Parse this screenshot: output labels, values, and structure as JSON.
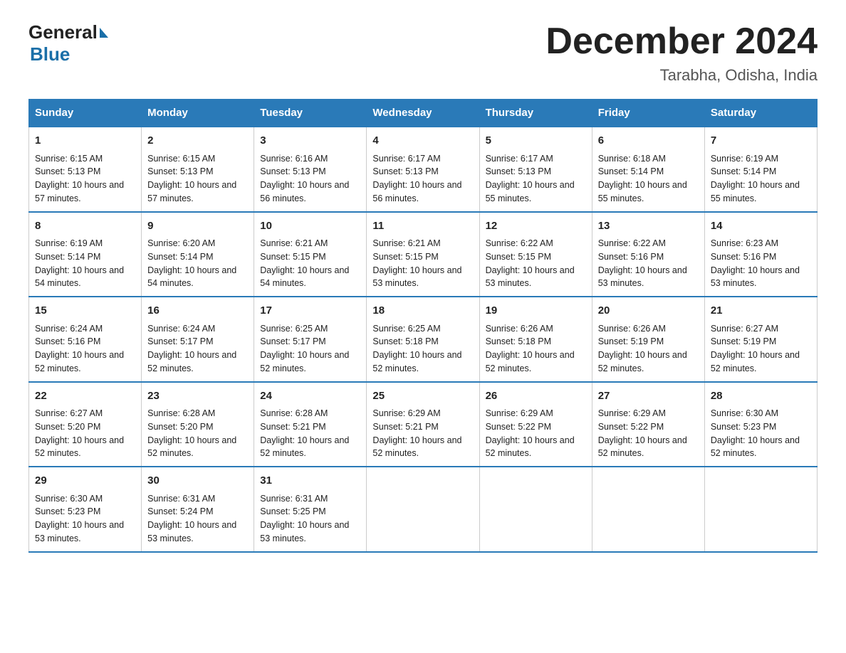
{
  "logo": {
    "general": "General",
    "blue": "Blue",
    "arrow_alt": "logo arrow"
  },
  "title": "December 2024",
  "subtitle": "Tarabha, Odisha, India",
  "days_of_week": [
    "Sunday",
    "Monday",
    "Tuesday",
    "Wednesday",
    "Thursday",
    "Friday",
    "Saturday"
  ],
  "weeks": [
    [
      {
        "day": "1",
        "sunrise": "6:15 AM",
        "sunset": "5:13 PM",
        "daylight": "10 hours and 57 minutes."
      },
      {
        "day": "2",
        "sunrise": "6:15 AM",
        "sunset": "5:13 PM",
        "daylight": "10 hours and 57 minutes."
      },
      {
        "day": "3",
        "sunrise": "6:16 AM",
        "sunset": "5:13 PM",
        "daylight": "10 hours and 56 minutes."
      },
      {
        "day": "4",
        "sunrise": "6:17 AM",
        "sunset": "5:13 PM",
        "daylight": "10 hours and 56 minutes."
      },
      {
        "day": "5",
        "sunrise": "6:17 AM",
        "sunset": "5:13 PM",
        "daylight": "10 hours and 55 minutes."
      },
      {
        "day": "6",
        "sunrise": "6:18 AM",
        "sunset": "5:14 PM",
        "daylight": "10 hours and 55 minutes."
      },
      {
        "day": "7",
        "sunrise": "6:19 AM",
        "sunset": "5:14 PM",
        "daylight": "10 hours and 55 minutes."
      }
    ],
    [
      {
        "day": "8",
        "sunrise": "6:19 AM",
        "sunset": "5:14 PM",
        "daylight": "10 hours and 54 minutes."
      },
      {
        "day": "9",
        "sunrise": "6:20 AM",
        "sunset": "5:14 PM",
        "daylight": "10 hours and 54 minutes."
      },
      {
        "day": "10",
        "sunrise": "6:21 AM",
        "sunset": "5:15 PM",
        "daylight": "10 hours and 54 minutes."
      },
      {
        "day": "11",
        "sunrise": "6:21 AM",
        "sunset": "5:15 PM",
        "daylight": "10 hours and 53 minutes."
      },
      {
        "day": "12",
        "sunrise": "6:22 AM",
        "sunset": "5:15 PM",
        "daylight": "10 hours and 53 minutes."
      },
      {
        "day": "13",
        "sunrise": "6:22 AM",
        "sunset": "5:16 PM",
        "daylight": "10 hours and 53 minutes."
      },
      {
        "day": "14",
        "sunrise": "6:23 AM",
        "sunset": "5:16 PM",
        "daylight": "10 hours and 53 minutes."
      }
    ],
    [
      {
        "day": "15",
        "sunrise": "6:24 AM",
        "sunset": "5:16 PM",
        "daylight": "10 hours and 52 minutes."
      },
      {
        "day": "16",
        "sunrise": "6:24 AM",
        "sunset": "5:17 PM",
        "daylight": "10 hours and 52 minutes."
      },
      {
        "day": "17",
        "sunrise": "6:25 AM",
        "sunset": "5:17 PM",
        "daylight": "10 hours and 52 minutes."
      },
      {
        "day": "18",
        "sunrise": "6:25 AM",
        "sunset": "5:18 PM",
        "daylight": "10 hours and 52 minutes."
      },
      {
        "day": "19",
        "sunrise": "6:26 AM",
        "sunset": "5:18 PM",
        "daylight": "10 hours and 52 minutes."
      },
      {
        "day": "20",
        "sunrise": "6:26 AM",
        "sunset": "5:19 PM",
        "daylight": "10 hours and 52 minutes."
      },
      {
        "day": "21",
        "sunrise": "6:27 AM",
        "sunset": "5:19 PM",
        "daylight": "10 hours and 52 minutes."
      }
    ],
    [
      {
        "day": "22",
        "sunrise": "6:27 AM",
        "sunset": "5:20 PM",
        "daylight": "10 hours and 52 minutes."
      },
      {
        "day": "23",
        "sunrise": "6:28 AM",
        "sunset": "5:20 PM",
        "daylight": "10 hours and 52 minutes."
      },
      {
        "day": "24",
        "sunrise": "6:28 AM",
        "sunset": "5:21 PM",
        "daylight": "10 hours and 52 minutes."
      },
      {
        "day": "25",
        "sunrise": "6:29 AM",
        "sunset": "5:21 PM",
        "daylight": "10 hours and 52 minutes."
      },
      {
        "day": "26",
        "sunrise": "6:29 AM",
        "sunset": "5:22 PM",
        "daylight": "10 hours and 52 minutes."
      },
      {
        "day": "27",
        "sunrise": "6:29 AM",
        "sunset": "5:22 PM",
        "daylight": "10 hours and 52 minutes."
      },
      {
        "day": "28",
        "sunrise": "6:30 AM",
        "sunset": "5:23 PM",
        "daylight": "10 hours and 52 minutes."
      }
    ],
    [
      {
        "day": "29",
        "sunrise": "6:30 AM",
        "sunset": "5:23 PM",
        "daylight": "10 hours and 53 minutes."
      },
      {
        "day": "30",
        "sunrise": "6:31 AM",
        "sunset": "5:24 PM",
        "daylight": "10 hours and 53 minutes."
      },
      {
        "day": "31",
        "sunrise": "6:31 AM",
        "sunset": "5:25 PM",
        "daylight": "10 hours and 53 minutes."
      },
      {
        "day": "",
        "sunrise": "",
        "sunset": "",
        "daylight": ""
      },
      {
        "day": "",
        "sunrise": "",
        "sunset": "",
        "daylight": ""
      },
      {
        "day": "",
        "sunrise": "",
        "sunset": "",
        "daylight": ""
      },
      {
        "day": "",
        "sunrise": "",
        "sunset": "",
        "daylight": ""
      }
    ]
  ],
  "labels": {
    "sunrise_prefix": "Sunrise: ",
    "sunset_prefix": "Sunset: ",
    "daylight_prefix": "Daylight: "
  }
}
